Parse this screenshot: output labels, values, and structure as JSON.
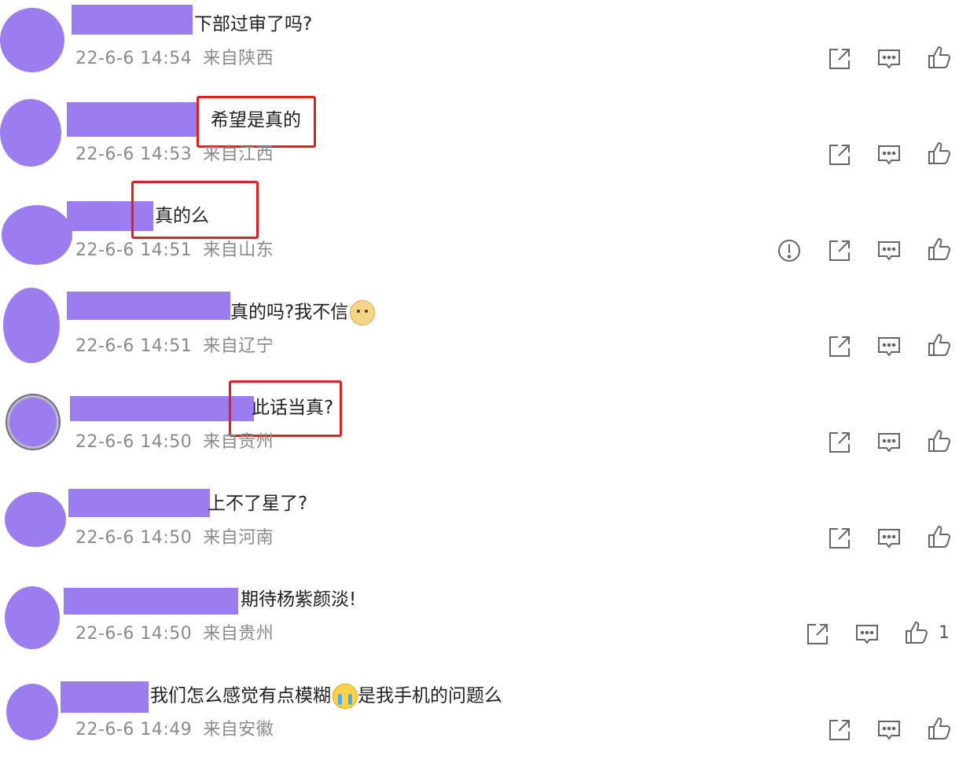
{
  "theme": {
    "redaction_color": "#9b7df0",
    "highlight_color": "#e02020"
  },
  "comments": [
    {
      "text": "下部过审了吗?",
      "date": "22-6-6 14:54",
      "place": "来自陕西"
    },
    {
      "text": "希望是真的",
      "date": "22-6-6 14:53",
      "place": "来自江西"
    },
    {
      "text": "真的么",
      "date": "22-6-6 14:51",
      "place": "来自山东"
    },
    {
      "text": "真的吗?我不信",
      "date": "22-6-6 14:51",
      "place": "来自辽宁"
    },
    {
      "text": "此话当真?",
      "date": "22-6-6 14:50",
      "place": "来自贵州"
    },
    {
      "text": "上不了星了?",
      "date": "22-6-6 14:50",
      "place": "来自河南"
    },
    {
      "text": "期待杨紫颜淡!",
      "date": "22-6-6 14:50",
      "place": "来自贵州",
      "like_count": "1"
    },
    {
      "text_a": "我们怎么感觉有点模糊",
      "text_b": "是我手机的问题么",
      "date": "22-6-6 14:49",
      "place": "来自安徽"
    }
  ],
  "icons": {
    "share": "share-icon",
    "comment": "comment-icon",
    "like": "thumbs-up-icon",
    "report": "report-icon"
  }
}
